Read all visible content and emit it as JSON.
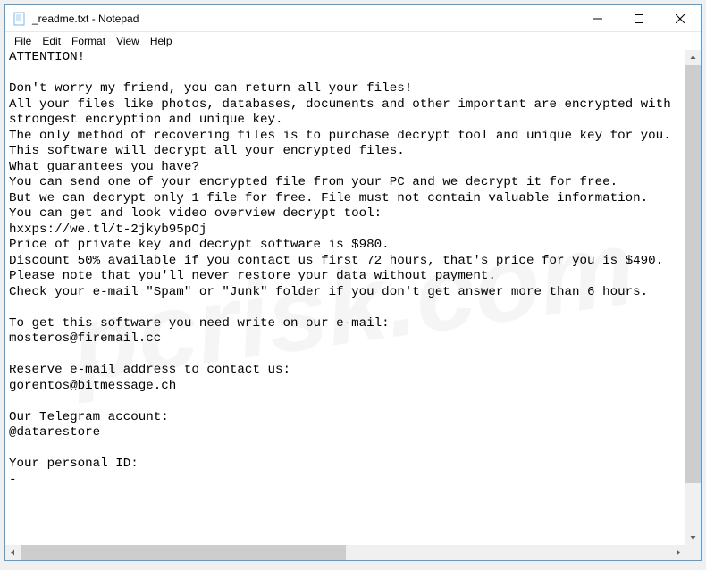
{
  "window": {
    "title": "_readme.txt - Notepad"
  },
  "menu": {
    "file": "File",
    "edit": "Edit",
    "format": "Format",
    "view": "View",
    "help": "Help"
  },
  "document": {
    "text": "ATTENTION!\n\nDon't worry my friend, you can return all your files!\nAll your files like photos, databases, documents and other important are encrypted with strongest encryption and unique key.\nThe only method of recovering files is to purchase decrypt tool and unique key for you.\nThis software will decrypt all your encrypted files.\nWhat guarantees you have?\nYou can send one of your encrypted file from your PC and we decrypt it for free.\nBut we can decrypt only 1 file for free. File must not contain valuable information.\nYou can get and look video overview decrypt tool:\nhxxps://we.tl/t-2jkyb95pOj\nPrice of private key and decrypt software is $980.\nDiscount 50% available if you contact us first 72 hours, that's price for you is $490.\nPlease note that you'll never restore your data without payment.\nCheck your e-mail \"Spam\" or \"Junk\" folder if you don't get answer more than 6 hours.\n\nTo get this software you need write on our e-mail:\nmosteros@firemail.cc\n\nReserve e-mail address to contact us:\ngorentos@bitmessage.ch\n\nOur Telegram account:\n@datarestore\n\nYour personal ID:\n-"
  },
  "watermark": "pcrisk.com"
}
